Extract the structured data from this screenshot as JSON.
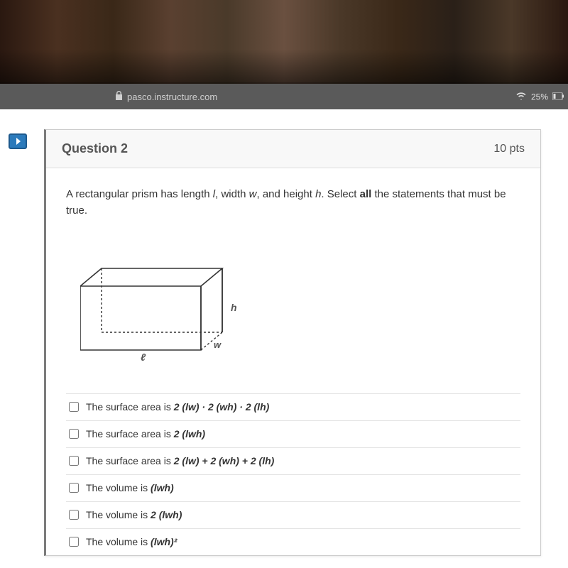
{
  "browser": {
    "url": "pasco.instructure.com",
    "battery": "25%"
  },
  "question": {
    "title": "Question 2",
    "points": "10 pts",
    "prompt_pre": "A rectangular prism has length ",
    "prompt_l": "l",
    "prompt_mid1": ", width ",
    "prompt_w": "w",
    "prompt_mid2": ", and height ",
    "prompt_h": "h",
    "prompt_post1": ". Select ",
    "prompt_all": "all",
    "prompt_post2": " the statements that must be true."
  },
  "diagram": {
    "label_l": "ℓ",
    "label_w": "w",
    "label_h": "h"
  },
  "options": [
    {
      "pre": "The surface area is ",
      "formula": "2 (lw) · 2 (wh) · 2 (lh)"
    },
    {
      "pre": "The surface area is ",
      "formula": "2 (lwh)"
    },
    {
      "pre": "The surface area is ",
      "formula": "2 (lw) + 2 (wh) + 2 (lh)"
    },
    {
      "pre": "The volume is ",
      "formula": "(lwh)"
    },
    {
      "pre": "The volume is ",
      "formula": "2 (lwh)"
    },
    {
      "pre": "The volume is ",
      "formula": "(lwh)²"
    }
  ]
}
